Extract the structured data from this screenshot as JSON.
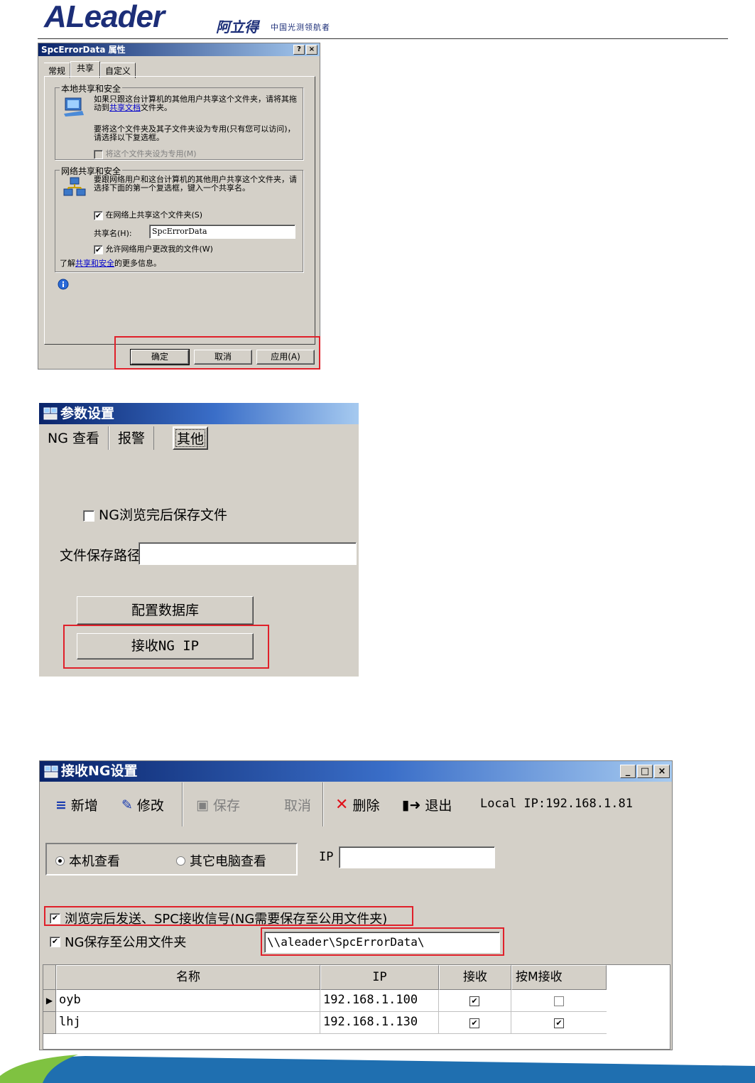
{
  "header": {
    "logo": "ALeader",
    "logo_cn": "阿立得",
    "tagline": "中国光测领航者"
  },
  "props_dialog": {
    "title": "SpcErrorData 属性",
    "title_buttons": [
      "?",
      "×"
    ],
    "tabs": [
      "常规",
      "共享",
      "自定义"
    ],
    "local_group": {
      "label": "本地共享和安全",
      "text1": "如果只跟这台计算机的其他用户共享这个文件夹，请将其拖动到",
      "text1_link": "共享文档",
      "text1_tail": "文件夹。",
      "text2": "要将这个文件夹及其子文件夹设为专用(只有您可以访问)，请选择以下复选框。",
      "private_cb": "将这个文件夹设为专用(M)"
    },
    "net_group": {
      "label": "网络共享和安全",
      "text": "要跟网络用户和这台计算机的其他用户共享这个文件夹，请选择下面的第一个复选框，键入一个共享名。",
      "share_cb": "在网络上共享这个文件夹(S)",
      "share_name_label": "共享名(H):",
      "share_name_value": "SpcErrorData",
      "allow_cb": "允许网络用户更改我的文件(W)",
      "learn_prefix": "了解",
      "learn_link": "共享和安全",
      "learn_suffix": "的更多信息。"
    },
    "buttons": {
      "ok": "确定",
      "cancel": "取消",
      "apply": "应用(A)"
    }
  },
  "params_dialog": {
    "title": "参数设置",
    "tabs": [
      "NG 查看",
      "报警",
      "其他"
    ],
    "save_cb": "NG浏览完后保存文件",
    "path_label": "文件保存路径",
    "path_value": "",
    "config_db": "配置数据库",
    "receive_ip": "接收NG IP"
  },
  "ng_dialog": {
    "title": "接收NG设置",
    "title_buttons": [
      "_",
      "□",
      "×"
    ],
    "toolbar": {
      "add": "新增",
      "edit": "修改",
      "save": "保存",
      "cancel": "取消",
      "delete": "删除",
      "exit": "退出",
      "local_ip": "Local IP:192.168.1.81"
    },
    "radio_local": "本机查看",
    "radio_other": "其它电脑查看",
    "ip_label": "IP",
    "ip_value": "",
    "cb_send": "浏览完后发送、SPC接收信号(NG需要保存至公用文件夹)",
    "cb_save_public": "NG保存至公用文件夹",
    "public_path": "\\\\aleader\\SpcErrorData\\",
    "table": {
      "headers": [
        "名称",
        "IP",
        "接收",
        "按M接收"
      ],
      "rows": [
        {
          "name": "oyb",
          "ip": "192.168.1.100",
          "recv": "✔",
          "recv_m": ""
        },
        {
          "name": "lhj",
          "ip": "192.168.1.130",
          "recv": "✔",
          "recv_m": "✔"
        }
      ]
    }
  },
  "colors": {
    "brand": "#1c2e78",
    "highlight": "#e0202a",
    "titlebar": "#0a246a",
    "swoosh_green": "#7fc241",
    "swoosh_blue": "#1f6fb0"
  }
}
